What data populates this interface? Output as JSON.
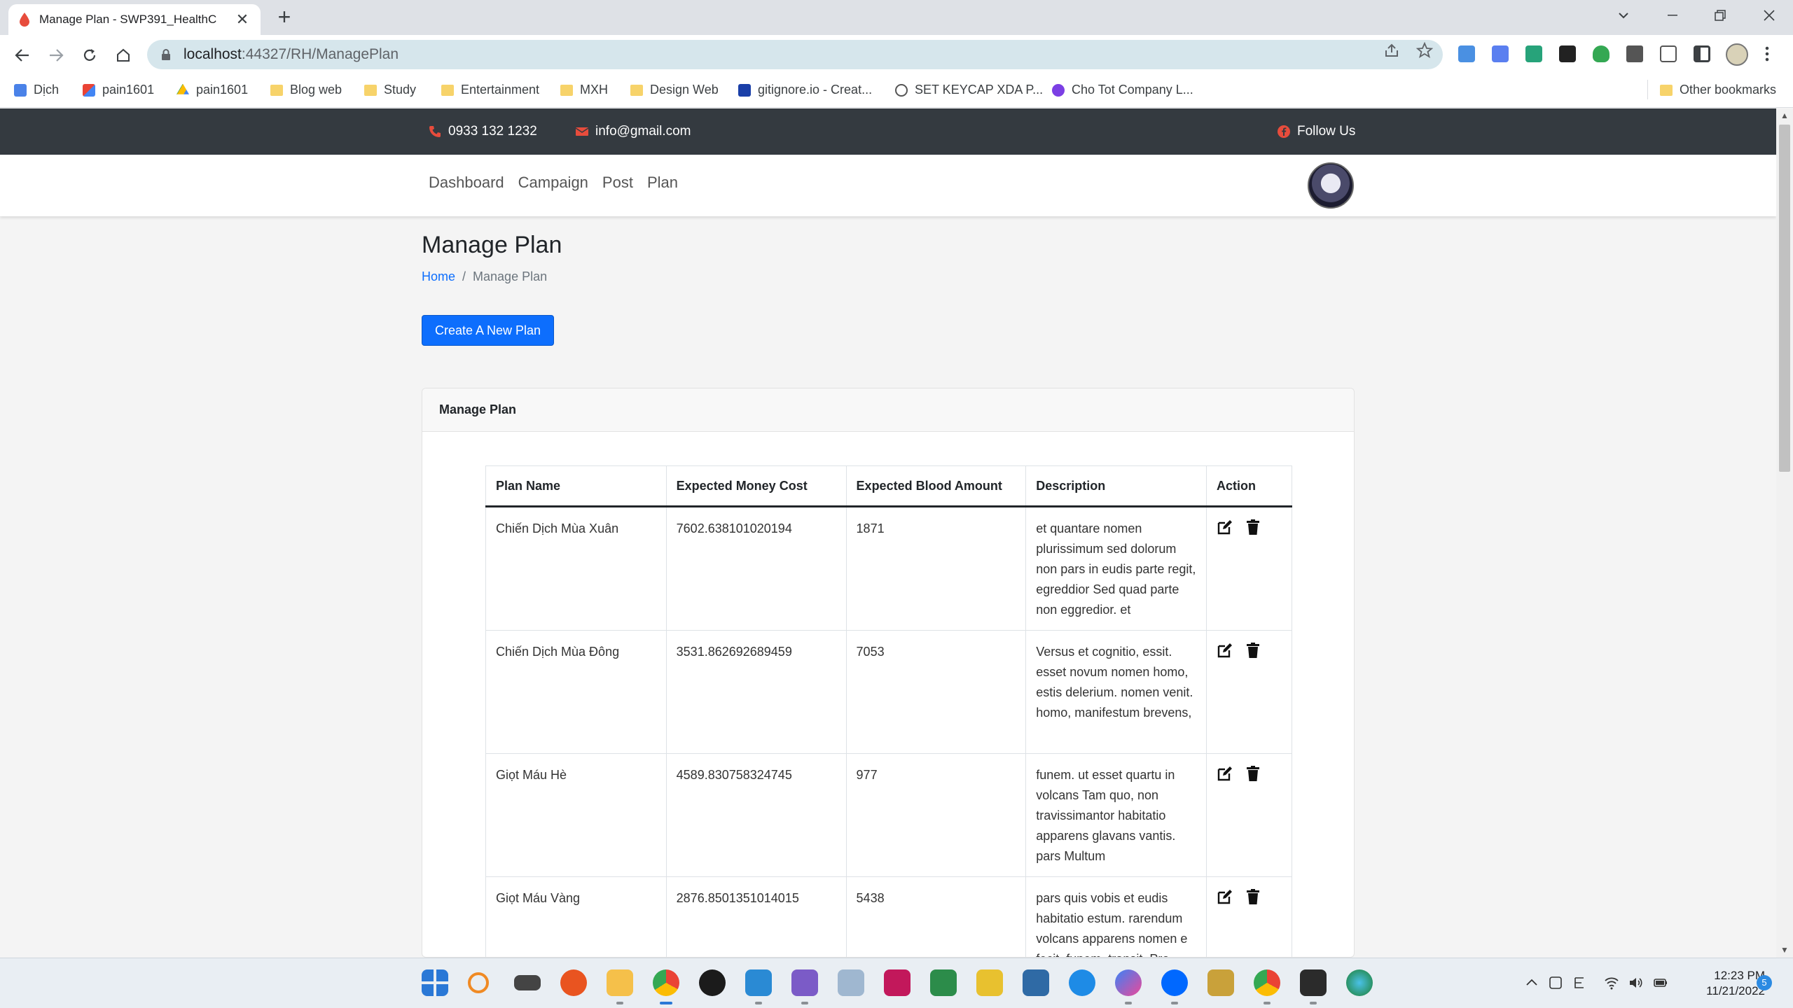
{
  "browser": {
    "tab_title": "Manage Plan - SWP391_HealthC",
    "tab_close": "✕",
    "new_tab": "+",
    "url_host": "localhost",
    "url_rest": ":44327/RH/ManagePlan"
  },
  "bookmarks": [
    {
      "label": "Dịch",
      "icon": "google-translate-icon"
    },
    {
      "label": "pain1601",
      "icon": "gmail-icon"
    },
    {
      "label": "pain1601",
      "icon": "google-drive-icon"
    },
    {
      "label": "Blog web",
      "icon": "folder-icon"
    },
    {
      "label": "Study",
      "icon": "folder-icon"
    },
    {
      "label": "Entertainment",
      "icon": "folder-icon"
    },
    {
      "label": "MXH",
      "icon": "folder-icon"
    },
    {
      "label": "Design Web",
      "icon": "folder-icon"
    },
    {
      "label": "gitignore.io - Creat...",
      "icon": "gitignore-icon"
    },
    {
      "label": "SET KEYCAP XDA P...",
      "icon": "keycap-icon"
    },
    {
      "label": "Cho Tot Company L...",
      "icon": "chotot-icon"
    }
  ],
  "other_bookmarks": "Other bookmarks",
  "topbar": {
    "phone": "0933 132 1232",
    "email": "info@gmail.com",
    "follow": "Follow Us"
  },
  "nav": {
    "items": [
      "Dashboard",
      "Campaign",
      "Post",
      "Plan"
    ]
  },
  "page": {
    "title": "Manage Plan",
    "breadcrumb_home": "Home",
    "breadcrumb_sep": "/",
    "breadcrumb_current": "Manage Plan",
    "create_button": "Create A New Plan",
    "card_title": "Manage Plan"
  },
  "table": {
    "headers": [
      "Plan Name",
      "Expected Money Cost",
      "Expected Blood Amount",
      "Description",
      "Action"
    ],
    "rows": [
      {
        "name": "Chiến Dịch Mùa Xuân",
        "cost": "7602.638101020194",
        "blood": "1871",
        "description": "et quantare nomen plurissimum sed dolorum non pars in eudis parte regit, egreddior Sed quad parte non eggredior. et"
      },
      {
        "name": "Chiến Dịch Mùa Đông",
        "cost": "3531.862692689459",
        "blood": "7053",
        "description": "Versus et cognitio, essit. esset novum nomen homo, estis delerium. nomen venit. homo, manifestum brevens,"
      },
      {
        "name": "Giọt Máu Hè",
        "cost": "4589.830758324745",
        "blood": "977",
        "description": "funem. ut esset quartu in volcans Tam quo, non travissimantor habitatio apparens glavans vantis. pars Multum"
      },
      {
        "name": "Giọt Máu Vàng",
        "cost": "2876.8501351014015",
        "blood": "5438",
        "description": "pars quis vobis et eudis habitatio estum. rarendum volcans apparens nomen e fecit. funem. transit. Pro"
      }
    ]
  },
  "taskbar": {
    "time": "12:23 PM",
    "date": "11/21/2022",
    "notifications": "5"
  },
  "colors": {
    "primary": "#0d6efd",
    "topbar": "#343a40",
    "accent_red": "#e74c3c"
  }
}
